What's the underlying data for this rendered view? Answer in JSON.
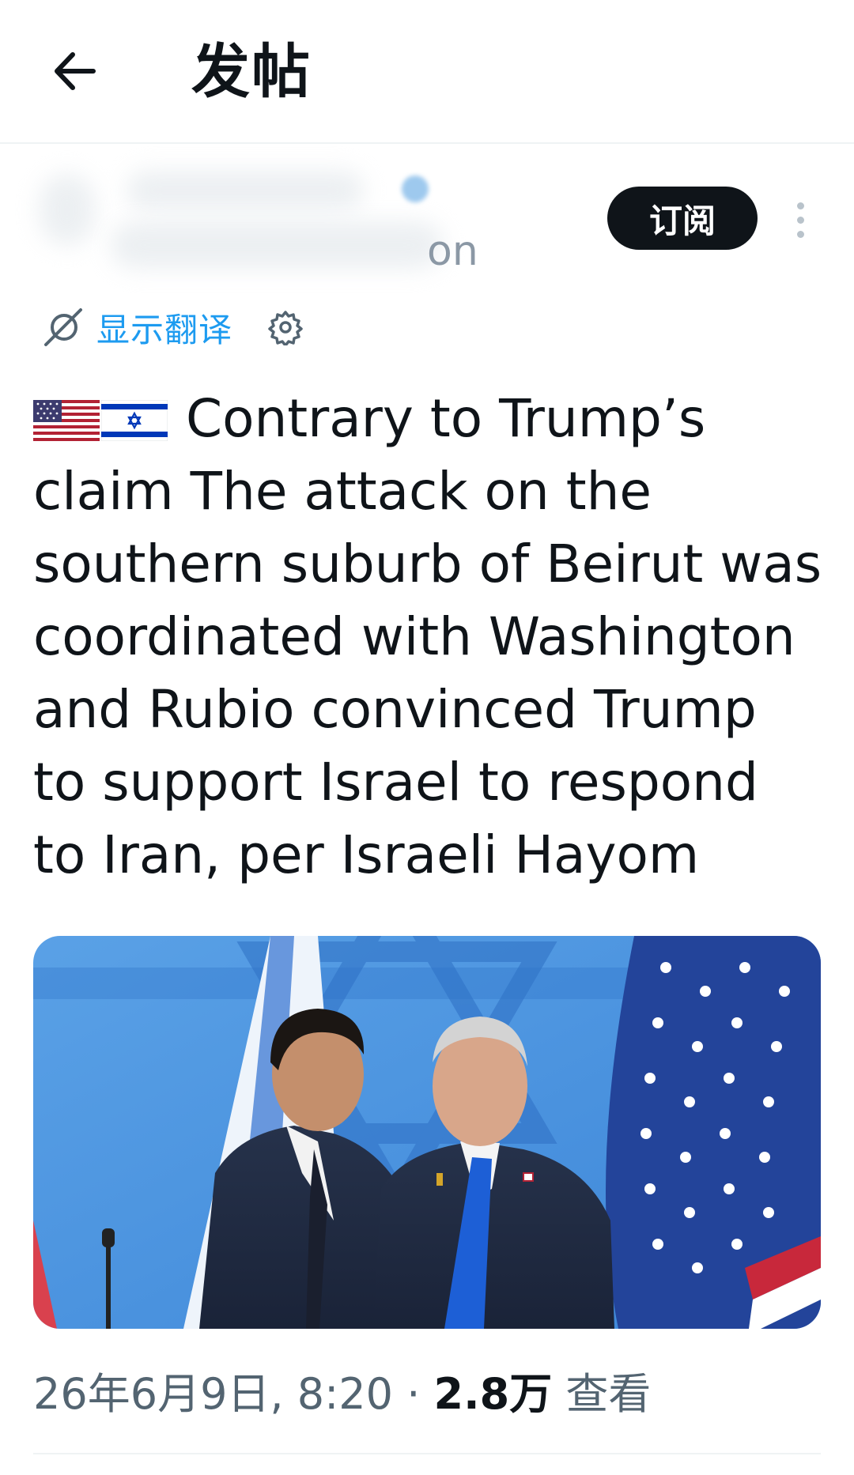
{
  "header": {
    "back_icon": "arrow-left-icon",
    "title": "发帖"
  },
  "author": {
    "handle_fragment": "on",
    "subscribe_label": "订阅",
    "more_icon": "more-vertical-icon"
  },
  "translation": {
    "icon": "translate-icon",
    "label": "显示翻译",
    "settings_icon": "gear-icon"
  },
  "tweet": {
    "flags": [
      "us-flag-icon",
      "israel-flag-icon"
    ],
    "text": "Contrary to Trump’s claim The attack on the southern suburb of Beirut was coordinated with Washington and Rubio convinced Trump to support Israel to respond to Iran, per Israeli Hayom",
    "image_description": "photo-two-men-embracing-before-flags"
  },
  "meta": {
    "date_time": "26年6月9日, 8:20",
    "separator": "·",
    "views_count": "2.8万",
    "views_label": "查看"
  },
  "colors": {
    "accent": "#1d9bf0",
    "text": "#0f1419",
    "secondary": "#536471",
    "button_bg": "#0f1419"
  }
}
